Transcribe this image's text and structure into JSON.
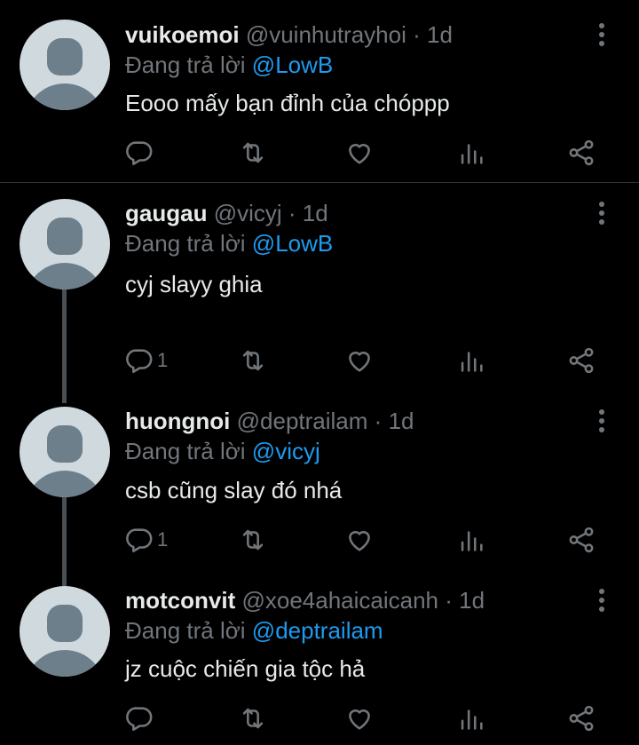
{
  "tweets": [
    {
      "username": "vuikoemoi",
      "handle": "@vuinhutrayhoi",
      "dot": "·",
      "time": "1d",
      "reply_prefix": "Đang trả lời",
      "reply_to": "@LowB",
      "text": "Eooo mấy bạn đỉnh của chóppp",
      "reply_count": ""
    },
    {
      "username": "gaugau",
      "handle": "@vicyj",
      "dot": "·",
      "time": "1d",
      "reply_prefix": "Đang trả lời",
      "reply_to": "@LowB",
      "text": "cyj slayy ghia",
      "reply_count": "1"
    },
    {
      "username": "huongnoi",
      "handle": "@deptrailam",
      "dot": "·",
      "time": "1d",
      "reply_prefix": "Đang trả lời",
      "reply_to": "@vicyj",
      "text": "csb cũng slay đó nhá",
      "reply_count": "1"
    },
    {
      "username": "motconvit",
      "handle": "@xoe4ahaicaicanh",
      "dot": "·",
      "time": "1d",
      "reply_prefix": "Đang trả lời",
      "reply_to": "@deptrailam",
      "text": "jz cuộc chiến gia tộc hả",
      "reply_count": ""
    }
  ],
  "icons": {
    "reply": "reply-icon",
    "retweet": "retweet-icon",
    "like": "heart-icon",
    "views": "analytics-icon",
    "share": "share-icon",
    "more": "more-vertical-icon"
  },
  "colors": {
    "background": "#000000",
    "text": "#e7e9ea",
    "secondary": "#71767b",
    "mention": "#1d9bf0",
    "avatar_bg": "#cfd9de",
    "avatar_fg": "#6e7f8c"
  }
}
